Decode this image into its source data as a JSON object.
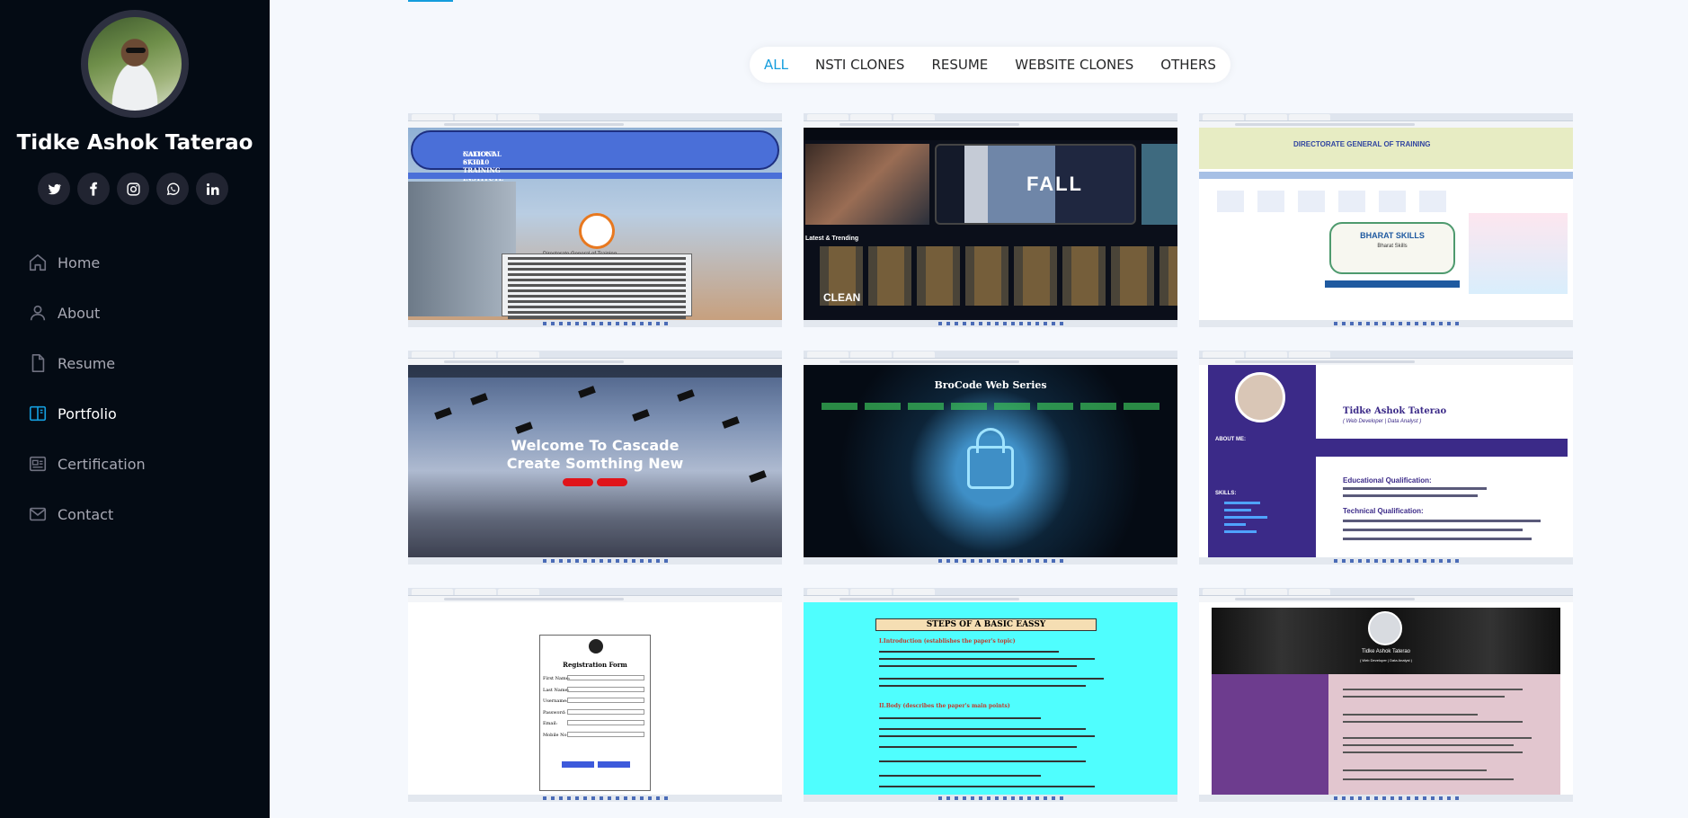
{
  "profile": {
    "name": "Tidke Ashok Taterao"
  },
  "socials": [
    {
      "icon": "twitter-icon"
    },
    {
      "icon": "facebook-icon"
    },
    {
      "icon": "instagram-icon"
    },
    {
      "icon": "whatsapp-icon"
    },
    {
      "icon": "linkedin-icon"
    }
  ],
  "nav": {
    "items": [
      {
        "label": "Home",
        "icon": "home-icon"
      },
      {
        "label": "About",
        "icon": "person-icon"
      },
      {
        "label": "Resume",
        "icon": "file-icon"
      },
      {
        "label": "Portfolio",
        "icon": "book-icon",
        "active": true
      },
      {
        "label": "Certification",
        "icon": "certificate-icon"
      },
      {
        "label": "Contact",
        "icon": "envelope-icon"
      }
    ]
  },
  "filters": {
    "items": [
      "ALL",
      "NSTI CLONES",
      "RESUME",
      "WEBSITE CLONES",
      "OTHERS"
    ],
    "active": "ALL"
  },
  "colors": {
    "sidebar_bg": "#040b14",
    "accent": "#149ddd",
    "main_bg": "#f5f8fd"
  },
  "portfolio": {
    "items": [
      {
        "thumb": {
          "line1": "NATIONAL SKILL TRAINING INSTITUTE",
          "line2": "CALICUT-673010",
          "caption": "Directorate General of Training"
        }
      },
      {
        "thumb": {
          "heading": "Latest & Trending",
          "poster": "FALL",
          "poster2": "CLEAN"
        }
      },
      {
        "thumb": {
          "title": "DIRECTORATE GENERAL OF TRAINING",
          "card_title": "BHARAT SKILLS",
          "card_sub": "Bharat Skills"
        }
      },
      {
        "thumb": {
          "line1": "Welcome To Cascade",
          "line2": "Create Somthing New"
        }
      },
      {
        "thumb": {
          "title": "BroCode Web Series"
        }
      },
      {
        "thumb": {
          "name": "Tidke Ashok Taterao",
          "subtitle": "( Web Developer | Data Analyst )",
          "section1": "Educational Qualification:",
          "section2": "Technical Qualification:",
          "about": "ABOUT ME:",
          "skills": "SKILLS:"
        }
      },
      {
        "thumb": {
          "title": "Registration Form",
          "fields": [
            "First Name:",
            "Last Name:",
            "Username:",
            "Password:",
            "Email:",
            "Mobile No:"
          ]
        }
      },
      {
        "thumb": {
          "title": "STEPS OF A BASIC EASSY",
          "h1": "I.Introduction (establishes the paper's topic)",
          "h2": "II.Body (describes the paper's main points)"
        }
      },
      {
        "thumb": {
          "name": "Tidke Ashok Taterao",
          "subtitle": "( Web Developer | Data Analyst )"
        }
      }
    ]
  }
}
